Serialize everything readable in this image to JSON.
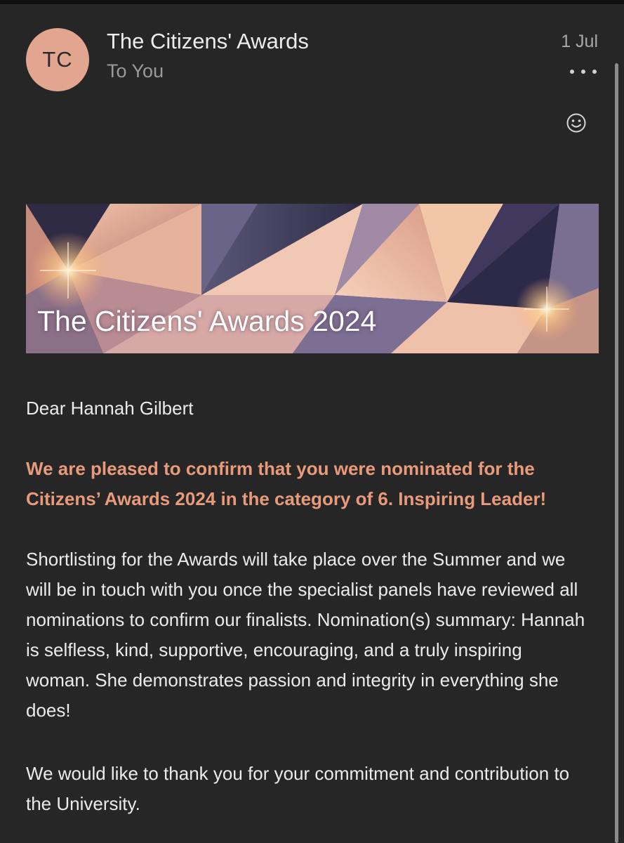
{
  "email": {
    "avatar_initials": "TC",
    "sender": "The Citizens' Awards",
    "recipient": "To You",
    "date": "1 Jul"
  },
  "actions": {
    "more_icon": "more-horizontal-icon",
    "react_icon": "smiley-icon"
  },
  "banner": {
    "title": "The Citizens' Awards 2024"
  },
  "body": {
    "greeting": "Dear Hannah Gilbert",
    "highlight": "We are pleased to confirm that you were nominated for the Citizens’ Awards 2024 in the category of 6. Inspiring Leader!",
    "paragraph": "Shortlisting for the Awards will take place over the Summer and we will be in touch with you once the specialist panels have reviewed all nominations to confirm our finalists. Nomination(s) summary: Hannah is selfless, kind, supportive, encouraging, and a truly inspiring woman. She demonstrates passion and integrity in everything she does!",
    "thanks": "We would like to thank you for your commitment and contribution to the University."
  },
  "colors": {
    "background": "#262626",
    "avatar": "#e2a690",
    "highlight_text": "#e89a7a",
    "secondary_text": "#9a9a9a"
  }
}
